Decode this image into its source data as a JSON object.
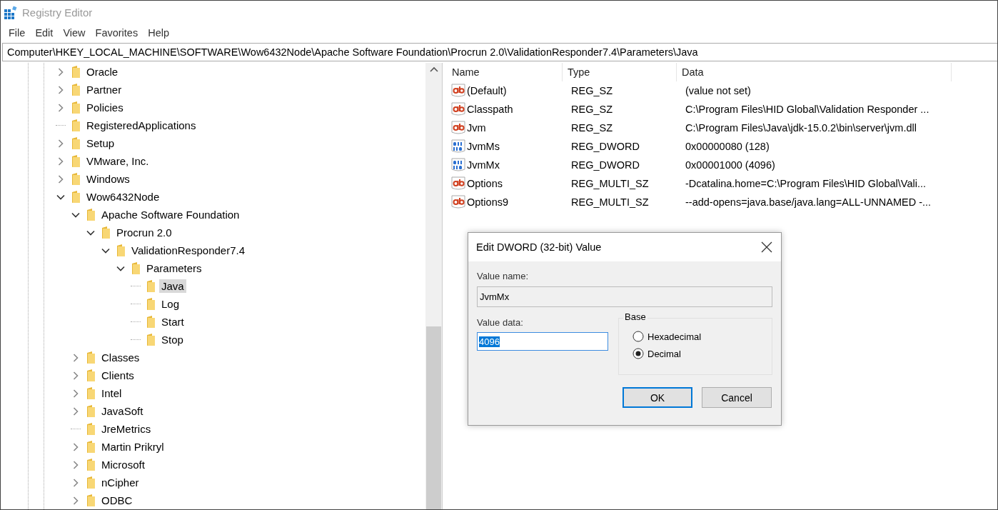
{
  "window": {
    "title": "Registry Editor"
  },
  "menu": [
    "File",
    "Edit",
    "View",
    "Favorites",
    "Help"
  ],
  "address": "Computer\\HKEY_LOCAL_MACHINE\\SOFTWARE\\Wow6432Node\\Apache Software Foundation\\Procrun 2.0\\ValidationResponder7.4\\Parameters\\Java",
  "tree": [
    {
      "name": "Oracle",
      "kind": "expandable",
      "expanded": false,
      "selected": false
    },
    {
      "name": "Partner",
      "kind": "expandable",
      "expanded": false,
      "selected": false
    },
    {
      "name": "Policies",
      "kind": "expandable",
      "expanded": false,
      "selected": false
    },
    {
      "name": "RegisteredApplications",
      "kind": "leaf",
      "selected": false
    },
    {
      "name": "Setup",
      "kind": "expandable",
      "expanded": false,
      "selected": false
    },
    {
      "name": "VMware, Inc.",
      "kind": "expandable",
      "expanded": false,
      "selected": false
    },
    {
      "name": "Windows",
      "kind": "expandable",
      "expanded": false,
      "selected": false
    },
    {
      "name": "Wow6432Node",
      "kind": "expandable",
      "expanded": true,
      "selected": false,
      "children": [
        {
          "name": "Apache Software Foundation",
          "kind": "expandable",
          "expanded": true,
          "selected": false,
          "children": [
            {
              "name": "Procrun 2.0",
              "kind": "expandable",
              "expanded": true,
              "selected": false,
              "children": [
                {
                  "name": "ValidationResponder7.4",
                  "kind": "expandable",
                  "expanded": true,
                  "selected": false,
                  "children": [
                    {
                      "name": "Parameters",
                      "kind": "expandable",
                      "expanded": true,
                      "selected": false,
                      "children": [
                        {
                          "name": "Java",
                          "kind": "leaf",
                          "selected": true
                        },
                        {
                          "name": "Log",
                          "kind": "leaf",
                          "selected": false
                        },
                        {
                          "name": "Start",
                          "kind": "leaf",
                          "selected": false
                        },
                        {
                          "name": "Stop",
                          "kind": "leaf",
                          "selected": false
                        }
                      ]
                    }
                  ]
                }
              ]
            }
          ]
        },
        {
          "name": "Classes",
          "kind": "expandable",
          "expanded": false,
          "selected": false
        },
        {
          "name": "Clients",
          "kind": "expandable",
          "expanded": false,
          "selected": false
        },
        {
          "name": "Intel",
          "kind": "expandable",
          "expanded": false,
          "selected": false
        },
        {
          "name": "JavaSoft",
          "kind": "expandable",
          "expanded": false,
          "selected": false
        },
        {
          "name": "JreMetrics",
          "kind": "leaf",
          "selected": false
        },
        {
          "name": "Martin Prikryl",
          "kind": "expandable",
          "expanded": false,
          "selected": false
        },
        {
          "name": "Microsoft",
          "kind": "expandable",
          "expanded": false,
          "selected": false
        },
        {
          "name": "nCipher",
          "kind": "expandable",
          "expanded": false,
          "selected": false
        },
        {
          "name": "ODBC",
          "kind": "expandable",
          "expanded": false,
          "selected": false
        }
      ]
    }
  ],
  "values": {
    "columns": [
      "Name",
      "Type",
      "Data"
    ],
    "rows": [
      {
        "kind": "string",
        "name": "(Default)",
        "type": "REG_SZ",
        "data": "(value not set)"
      },
      {
        "kind": "string",
        "name": "Classpath",
        "type": "REG_SZ",
        "data": "C:\\Program Files\\HID Global\\Validation Responder ..."
      },
      {
        "kind": "string",
        "name": "Jvm",
        "type": "REG_SZ",
        "data": "C:\\Program Files\\Java\\jdk-15.0.2\\bin\\server\\jvm.dll"
      },
      {
        "kind": "dword",
        "name": "JvmMs",
        "type": "REG_DWORD",
        "data": "0x00000080 (128)"
      },
      {
        "kind": "dword",
        "name": "JvmMx",
        "type": "REG_DWORD",
        "data": "0x00001000 (4096)"
      },
      {
        "kind": "string",
        "name": "Options",
        "type": "REG_MULTI_SZ",
        "data": "-Dcatalina.home=C:\\Program Files\\HID Global\\Vali..."
      },
      {
        "kind": "string",
        "name": "Options9",
        "type": "REG_MULTI_SZ",
        "data": "--add-opens=java.base/java.lang=ALL-UNNAMED -..."
      }
    ]
  },
  "dialog": {
    "title": "Edit DWORD (32-bit) Value",
    "name_label": "Value name:",
    "name_value": "JvmMx",
    "data_label": "Value data:",
    "data_value": "4096",
    "base_label": "Base",
    "bases": [
      {
        "label": "Hexadecimal",
        "selected": false
      },
      {
        "label": "Decimal",
        "selected": true
      }
    ],
    "buttons": [
      {
        "label": "OK",
        "kind": "default"
      },
      {
        "label": "Cancel",
        "kind": "normal"
      }
    ]
  }
}
